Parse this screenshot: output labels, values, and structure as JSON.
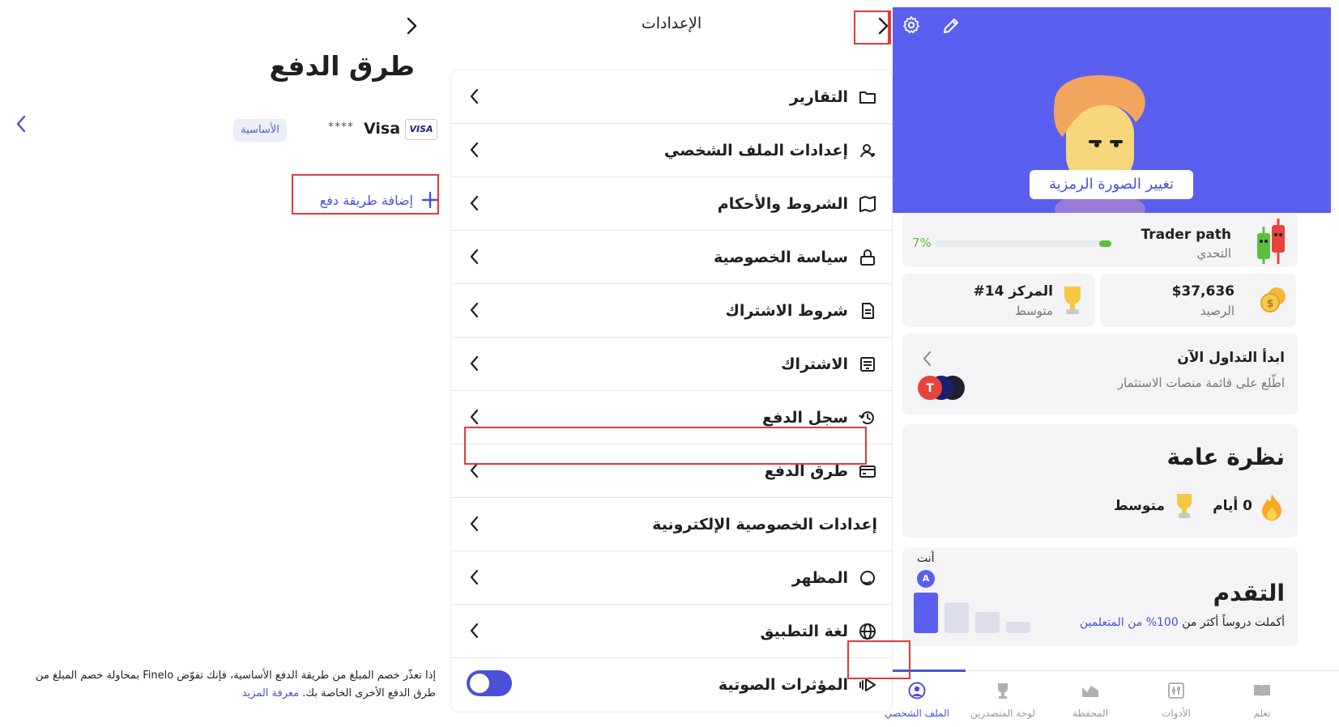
{
  "payment_methods": {
    "title": "طرق الدفع",
    "card": {
      "brand_badge": "VISA",
      "brand": "Visa",
      "mask": "****",
      "primary_label": "الأساسية"
    },
    "add_label": "إضافة طريقة دفع",
    "footnote": "إذا تعذّر خصم المبلغ من طريقة الدفع الأساسية، فإنك تفوّض Finelo بمحاولة خصم المبلغ من طرق الدفع الأخرى الخاصة بك.",
    "learn_more": "معرفة المزيد"
  },
  "settings": {
    "title": "الإعدادات",
    "items": [
      {
        "label": "التقارير",
        "icon": "folder-icon"
      },
      {
        "label": "إعدادات الملف الشخصي",
        "icon": "user-settings-icon"
      },
      {
        "label": "الشروط والأحكام",
        "icon": "map-icon"
      },
      {
        "label": "سياسة الخصوصية",
        "icon": "lock-icon"
      },
      {
        "label": "شروط الاشتراك",
        "icon": "document-icon"
      },
      {
        "label": "الاشتراك",
        "icon": "receipt-icon"
      },
      {
        "label": "سجل الدفع",
        "icon": "history-icon"
      },
      {
        "label": "طرق الدفع",
        "icon": "credit-card-icon"
      },
      {
        "label": "إعدادات الخصوصية الإلكترونية",
        "icon": "none"
      },
      {
        "label": "المظهر",
        "icon": "moon-icon"
      },
      {
        "label": "لغة التطبيق",
        "icon": "globe-icon"
      },
      {
        "label": "المؤثرات الصوتية",
        "icon": "sound-icon"
      }
    ],
    "sound_effects_on": true
  },
  "profile": {
    "change_avatar": "تغيير الصورة الرمزية",
    "trader_path": {
      "name": "Trader path",
      "subtitle": "التحدي",
      "percent_label": "7%",
      "progress": 0.07
    },
    "balance": {
      "value": "$37,636",
      "label": "الرصيد"
    },
    "rank": {
      "value": "المركز 14#",
      "label": "متوسط"
    },
    "start_trading": {
      "title": "ابدأ التداول الآن",
      "subtitle": "اطّلع على قائمة منصات الاستثمار"
    },
    "overview": {
      "title": "نظرة عامة",
      "streak": "0 أيام",
      "level": "متوسط"
    },
    "progress": {
      "title": "التقدم",
      "you_label": "أنت",
      "avatar_letter": "A",
      "text": "أكملت دروساً أكثر من",
      "highlight": "100% من المتعلمين"
    },
    "tabs": [
      {
        "label": "تعلم",
        "icon": "book-icon"
      },
      {
        "label": "الأدوات",
        "icon": "tools-icon"
      },
      {
        "label": "المحفظة",
        "icon": "portfolio-icon"
      },
      {
        "label": "لوحة المتصدرين",
        "icon": "trophy-icon"
      },
      {
        "label": "الملف الشخصي",
        "icon": "profile-icon"
      }
    ],
    "accent": "#5b5ff0"
  }
}
